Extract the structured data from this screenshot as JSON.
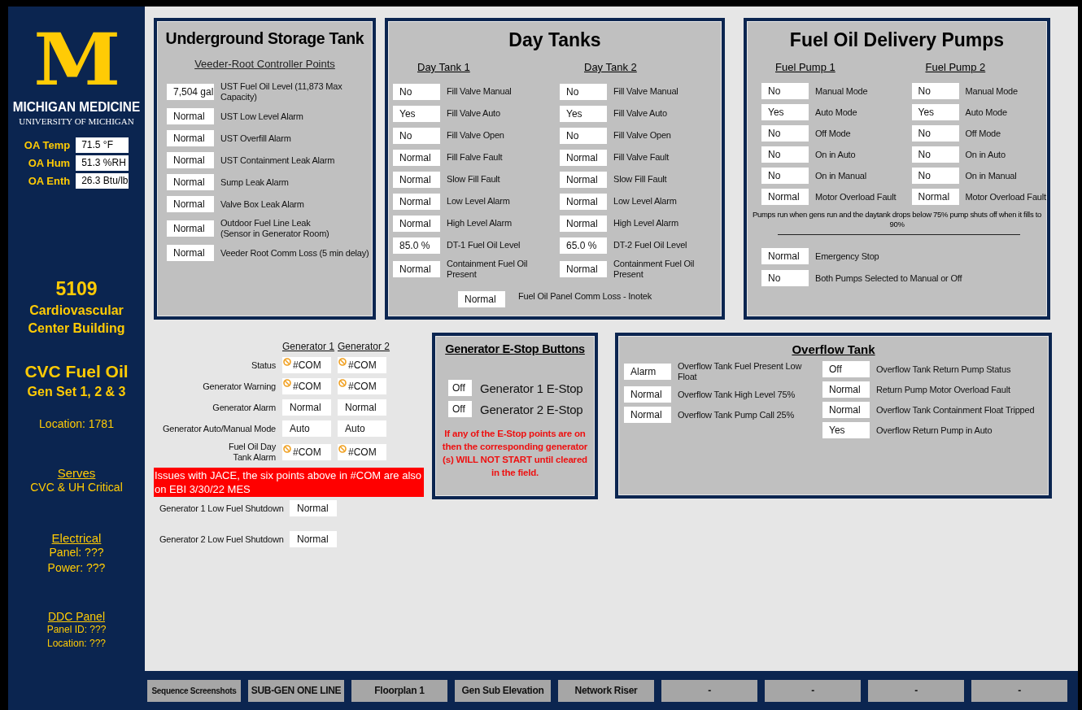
{
  "sidebar": {
    "logo_letter": "M",
    "brand": "MICHIGAN MEDICINE",
    "sub_brand": "UNIVERSITY OF MICHIGAN",
    "readings": [
      {
        "label": "OA Temp",
        "value": "71.5 °F"
      },
      {
        "label": "OA Hum",
        "value": "51.3 %RH"
      },
      {
        "label": "OA Enth",
        "value": "26.3 Btu/lb"
      }
    ],
    "building_number": "5109",
    "building_name": "Cardiovascular Center Building",
    "system_title": "CVC Fuel Oil",
    "system_subtitle": "Gen Set 1, 2 & 3",
    "location": "Location: 1781",
    "info_sections": [
      {
        "heading": "Serves",
        "lines": [
          "CVC & UH Critical"
        ],
        "large": true
      },
      {
        "heading": "Electrical",
        "lines": [
          "Panel: ???",
          "Power: ???"
        ],
        "large": true
      },
      {
        "heading": "DDC Panel",
        "lines": [
          "Panel ID: ???",
          "Location: ???"
        ],
        "large": false
      }
    ]
  },
  "ust": {
    "title": "Underground Storage Tank",
    "subtitle": "Veeder-Root Controller Points",
    "rows": [
      {
        "value": "7,504 gal",
        "label": "UST Fuel Oil Level (11,873 Max Capacity)"
      },
      {
        "value": "Normal",
        "label": "UST Low Level Alarm"
      },
      {
        "value": "Normal",
        "label": "UST Overfill Alarm"
      },
      {
        "value": "Normal",
        "label": "UST Containment Leak Alarm"
      },
      {
        "value": "Normal",
        "label": "Sump Leak Alarm"
      },
      {
        "value": "Normal",
        "label": "Valve Box Leak Alarm"
      },
      {
        "value": "Normal",
        "label": "Outdoor Fuel Line Leak\n(Sensor in Generator Room)"
      },
      {
        "value": "Normal",
        "label": "Veeder Root Comm Loss (5 min delay)"
      }
    ]
  },
  "day_tanks": {
    "title": "Day Tanks",
    "columns": [
      {
        "heading": "Day Tank 1",
        "rows": [
          {
            "value": "No",
            "label": "Fill Valve Manual"
          },
          {
            "value": "Yes",
            "label": "Fill Valve Auto"
          },
          {
            "value": "No",
            "label": "Fill Valve Open"
          },
          {
            "value": "Normal",
            "label": "Fill Falve Fault"
          },
          {
            "value": "Normal",
            "label": "Slow Fill Fault"
          },
          {
            "value": "Normal",
            "label": "Low Level Alarm"
          },
          {
            "value": "Normal",
            "label": "High Level Alarm"
          },
          {
            "value": "85.0 %",
            "label": "DT-1 Fuel Oil Level"
          },
          {
            "value": "Normal",
            "label": "Containment Fuel Oil Present"
          }
        ]
      },
      {
        "heading": "Day Tank 2",
        "rows": [
          {
            "value": "No",
            "label": "Fill Valve Manual"
          },
          {
            "value": "Yes",
            "label": "Fill Valve Auto"
          },
          {
            "value": "No",
            "label": "Fill Valve Open"
          },
          {
            "value": "Normal",
            "label": "Fill Valve Fault"
          },
          {
            "value": "Normal",
            "label": "Slow Fill Fault"
          },
          {
            "value": "Normal",
            "label": "Low Level Alarm"
          },
          {
            "value": "Normal",
            "label": "High Level Alarm"
          },
          {
            "value": "65.0 %",
            "label": "DT-2 Fuel Oil Level"
          },
          {
            "value": "Normal",
            "label": "Containment Fuel Oil Present"
          }
        ]
      }
    ],
    "footer": {
      "value": "Normal",
      "label": "Fuel Oil Panel Comm Loss - Inotek"
    }
  },
  "pumps": {
    "title": "Fuel Oil Delivery Pumps",
    "columns": [
      {
        "heading": "Fuel Pump 1",
        "rows": [
          {
            "value": "No",
            "label": "Manual Mode"
          },
          {
            "value": "Yes",
            "label": "Auto Mode"
          },
          {
            "value": "No",
            "label": "Off Mode"
          },
          {
            "value": "No",
            "label": "On in Auto"
          },
          {
            "value": "No",
            "label": "On in Manual"
          },
          {
            "value": "Normal",
            "label": "Motor Overload Fault"
          }
        ]
      },
      {
        "heading": "Fuel Pump 2",
        "rows": [
          {
            "value": "No",
            "label": "Manual Mode"
          },
          {
            "value": "Yes",
            "label": "Auto Mode"
          },
          {
            "value": "No",
            "label": "Off Mode"
          },
          {
            "value": "No",
            "label": "On in Auto"
          },
          {
            "value": "No",
            "label": "On in Manual"
          },
          {
            "value": "Normal",
            "label": "Motor Overload Fault"
          }
        ]
      }
    ],
    "note": "Pumps run when gens run and the daytank drops below 75% pump shuts off when it fills to 90%",
    "extra_rows": [
      {
        "value": "Normal",
        "label": "Emergency Stop"
      },
      {
        "value": "No",
        "label": "Both Pumps Selected to Manual or Off"
      }
    ]
  },
  "generators": {
    "headings": [
      "Generator 1",
      "Generator 2"
    ],
    "rows": [
      {
        "label": "Status",
        "values": [
          {
            "text": "#COM",
            "comm_fault": true
          },
          {
            "text": "#COM",
            "comm_fault": true
          }
        ]
      },
      {
        "label": "Generator Warning",
        "values": [
          {
            "text": "#COM",
            "comm_fault": true
          },
          {
            "text": "#COM",
            "comm_fault": true
          }
        ]
      },
      {
        "label": "Generator Alarm",
        "values": [
          {
            "text": "Normal",
            "comm_fault": false
          },
          {
            "text": "Normal",
            "comm_fault": false
          }
        ]
      },
      {
        "label": "Generator Auto/Manual Mode",
        "values": [
          {
            "text": "Auto",
            "comm_fault": false
          },
          {
            "text": "Auto",
            "comm_fault": false
          }
        ]
      },
      {
        "label": "Fuel Oil Day\nTank Alarm",
        "values": [
          {
            "text": "#COM",
            "comm_fault": true
          },
          {
            "text": "#COM",
            "comm_fault": true
          }
        ]
      }
    ],
    "banner": "Issues with JACE, the six points above in #COM are also on EBI 3/30/22 MES",
    "shutdown_rows": [
      {
        "label": "Generator 1 Low Fuel Shutdown",
        "value": "Normal"
      },
      {
        "label": "Generator 2 Low Fuel Shutdown",
        "value": "Normal"
      }
    ]
  },
  "estop": {
    "title": "Generator E-Stop Buttons",
    "rows": [
      {
        "value": "Off",
        "label": "Generator 1 E-Stop"
      },
      {
        "value": "Off",
        "label": "Generator 2 E-Stop"
      }
    ],
    "warning": "If any of the E-Stop points are on then the corresponding generator (s) WILL NOT START until cleared in the field."
  },
  "overflow": {
    "title": "Overflow Tank",
    "columns": [
      [
        {
          "value": "Alarm",
          "label": "Overflow Tank Fuel Present Low Float"
        },
        {
          "value": "Normal",
          "label": "Overflow Tank High Level 75%"
        },
        {
          "value": "Normal",
          "label": "Overflow Tank Pump Call 25%"
        }
      ],
      [
        {
          "value": "Off",
          "label": "Overflow Tank Return Pump Status"
        },
        {
          "value": "Normal",
          "label": "Return Pump Motor Overload Fault"
        },
        {
          "value": "Normal",
          "label": "Overflow Tank Containment Float Tripped"
        },
        {
          "value": "Yes",
          "label": "Overflow Return Pump in Auto"
        }
      ]
    ]
  },
  "nav_buttons": [
    "Sequence Screenshots",
    "SUB-GEN ONE LINE",
    "Floorplan 1",
    "Gen Sub Elevation",
    "Network Riser",
    "-",
    "-",
    "-",
    "-"
  ]
}
